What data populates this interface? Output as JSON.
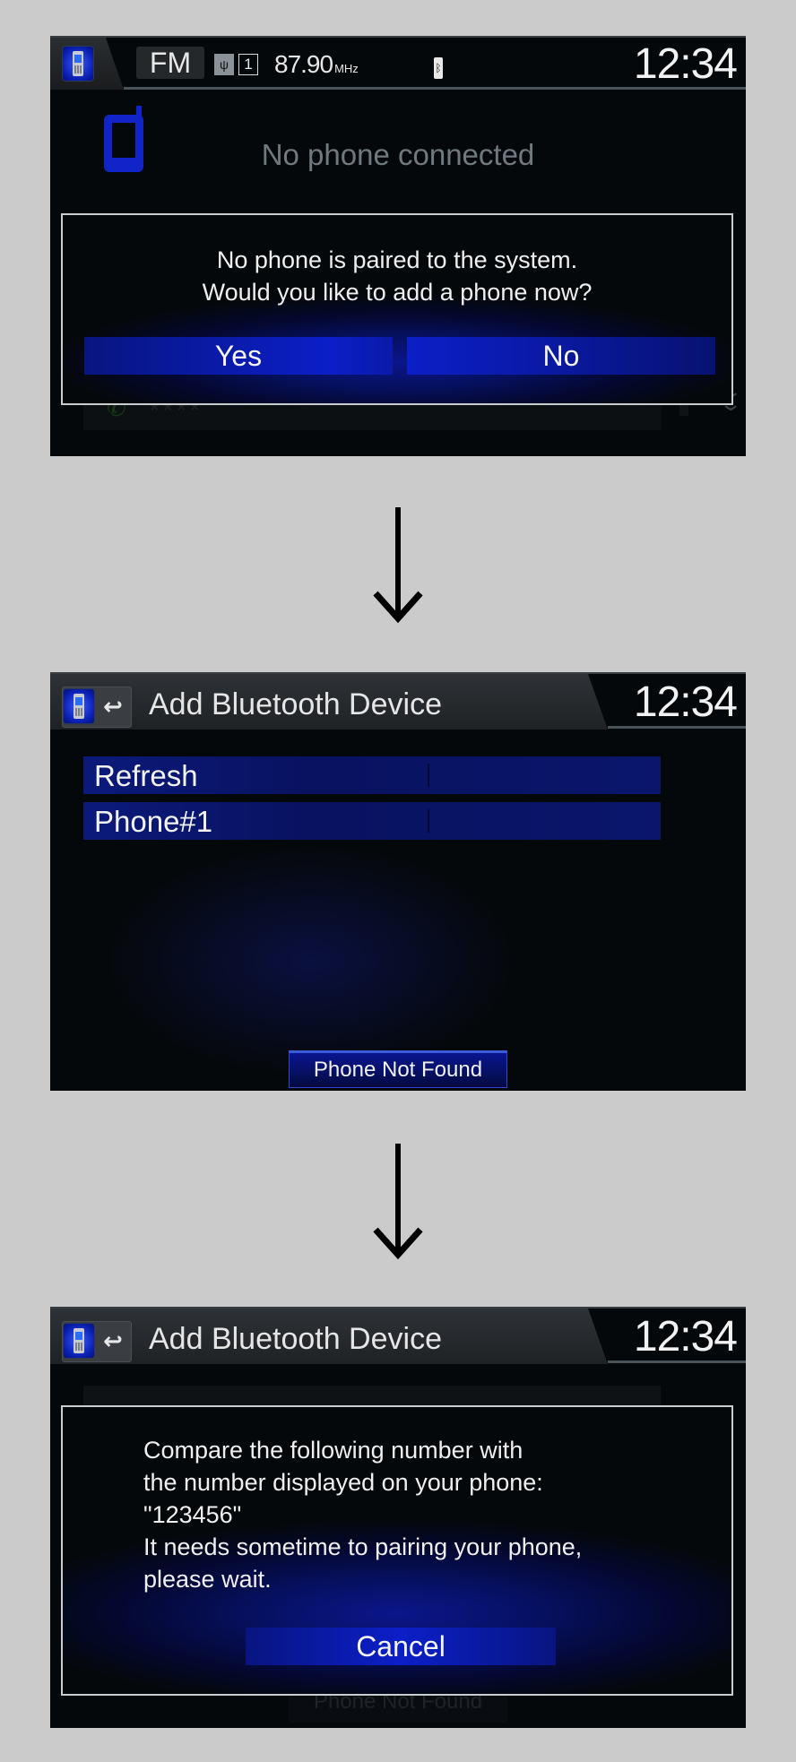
{
  "colors": {
    "page_background": "#cbcbcb",
    "screen_background": "#05080a",
    "accent_blue": "#0b1fc8",
    "dialog_border": "#c9cdd0",
    "text_primary": "#efefef",
    "text_muted": "#6f7a80"
  },
  "screen1": {
    "status_bar": {
      "phone_icon": "phone-icon",
      "source": "FM",
      "antenna_icon": "antenna-icon",
      "preset": "1",
      "frequency": "87.90",
      "frequency_unit": "MHz",
      "bluetooth_icon": "battery-bluetooth-icon",
      "clock": "12:34"
    },
    "status_message": "No phone connected",
    "background_list": [
      {
        "icon": "call-icon",
        "label": "****"
      },
      {
        "icon": "call-icon",
        "label": "****"
      }
    ],
    "scroll_icon": "double-chevron-down-icon",
    "dialog": {
      "lines": [
        "No phone is paired to the system.",
        "Would you like to add a phone now?"
      ],
      "yes_label": "Yes",
      "no_label": "No"
    }
  },
  "arrows": [
    {
      "icon": "arrow-down-icon"
    },
    {
      "icon": "arrow-down-icon"
    }
  ],
  "screen2": {
    "title_bar": {
      "phone_icon": "phone-icon",
      "back_icon": "back-icon",
      "back_glyph": "↩",
      "title": "Add Bluetooth Device",
      "clock": "12:34"
    },
    "menu_items": [
      {
        "label": "Refresh"
      },
      {
        "label": "Phone#1"
      }
    ],
    "phone_not_found_label": "Phone Not Found"
  },
  "screen3": {
    "title_bar": {
      "phone_icon": "phone-icon",
      "back_icon": "back-icon",
      "back_glyph": "↩",
      "title": "Add Bluetooth Device",
      "clock": "12:34"
    },
    "dialog": {
      "lines": [
        "Compare the following number with",
        "the number displayed on your phone:",
        "\"123456\"",
        "It needs sometime to pairing your phone,",
        "please wait."
      ],
      "cancel_label": "Cancel"
    },
    "phone_not_found_label": "Phone Not Found"
  }
}
